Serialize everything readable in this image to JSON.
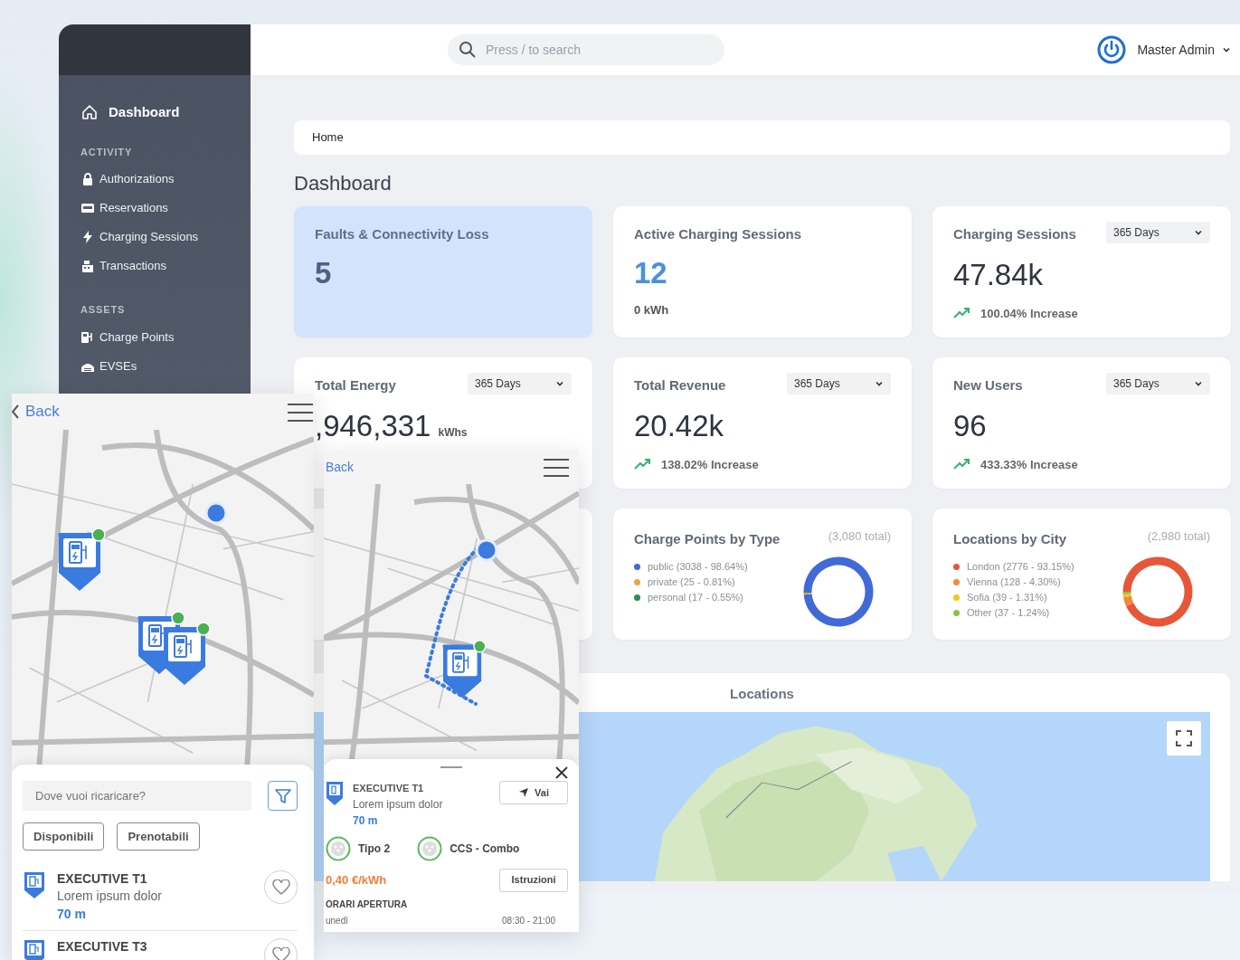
{
  "sidebar": {
    "home": "Dashboard",
    "sections": [
      {
        "title": "ACTIVITY",
        "items": [
          "Authorizations",
          "Reservations",
          "Charging Sessions",
          "Transactions"
        ]
      },
      {
        "title": "ASSETS",
        "items": [
          "Charge Points",
          "EVSEs"
        ]
      }
    ]
  },
  "header": {
    "search": {
      "placeholder": "Press / to search"
    },
    "user": "Master Admin"
  },
  "breadcrumb": "Home",
  "page_title": "Dashboard",
  "cards": [
    {
      "kind": "alert",
      "title": "Faults & Connectivity Loss",
      "value": "5"
    },
    {
      "kind": "stat",
      "title": "Active Charging Sessions",
      "value": "12",
      "note": "0 kWh"
    },
    {
      "kind": "trend",
      "title": "Charging Sessions",
      "period": "365 Days",
      "value": "47.84k",
      "change": "100.04% Increase"
    },
    {
      "kind": "trend",
      "title": "Total Energy",
      "period": "365 Days",
      "value": ",946,331",
      "unit": "kWhs"
    },
    {
      "kind": "trend",
      "title": "Total Revenue",
      "period": "365 Days",
      "value": "20.42k",
      "change": "138.02% Increase"
    },
    {
      "kind": "trend",
      "title": "New Users",
      "period": "365 Days",
      "value": "96",
      "change": "433.33% Increase"
    },
    {
      "kind": "donut",
      "title": "Charge Points by Type",
      "total": "(3,080 total)",
      "legend": [
        {
          "detail": "(3038 - 98.64%)",
          "color": "#4169d8"
        },
        {
          "detail": "(25 - 0.81%)",
          "color": "#f0a04b"
        },
        {
          "detail": "(17 - 0.55%)",
          "color": "#2e8b57"
        }
      ],
      "chart_data": {
        "type": "donut",
        "categories": [
          "public",
          "private",
          "personal"
        ],
        "values": [
          98.64,
          0.81,
          0.55
        ]
      }
    },
    {
      "kind": "donut",
      "title": "Locations by City",
      "total": "(2,980 total)",
      "legend": [
        {
          "detail": "(2776 - 93.15%)",
          "color": "#e8563a"
        },
        {
          "detail": "(128 - 4.30%)",
          "color": "#f08a3c"
        },
        {
          "detail": "(39 - 1.31%)",
          "color": "#f3c623"
        },
        {
          "detail": "(37 - 1.24%)",
          "color": "#8bc34a"
        }
      ],
      "chart_data": {
        "type": "donut",
        "categories": [
          "London",
          "Vienna",
          "Sofia",
          "Other"
        ],
        "values": [
          93.15,
          4.3,
          1.31,
          1.24
        ]
      }
    }
  ],
  "locations": {
    "title": "Locations"
  },
  "phone_list": {
    "back": "Back",
    "search": {
      "placeholder": "Dove vuoi ricaricare?"
    },
    "filters": [
      {
        "label": "Disponibili",
        "selected": false
      },
      {
        "label": "Prenotabili",
        "selected": false
      }
    ],
    "results": [
      {
        "name": "EXECUTIVE T1",
        "address": "Lorem ipsum dolor",
        "distance": "70 m",
        "favorite": false
      },
      {
        "name": "EXECUTIVE T3",
        "favorite": false
      }
    ]
  },
  "phone_detail": {
    "back": "Back",
    "station": {
      "name": "EXECUTIVE T1",
      "address": "Lorem ipsum dolor",
      "distance": "70 m"
    },
    "go_button": "Vai",
    "connectors": [
      "Tipo 2",
      "CCS - Combo"
    ],
    "price": "0,40 €/kWh",
    "instructions_button": "Istruzioni",
    "hours_title": "ORARI APERTURA",
    "hours": [
      {
        "day": "unedì",
        "time": "08:30 - 21:00"
      }
    ]
  }
}
